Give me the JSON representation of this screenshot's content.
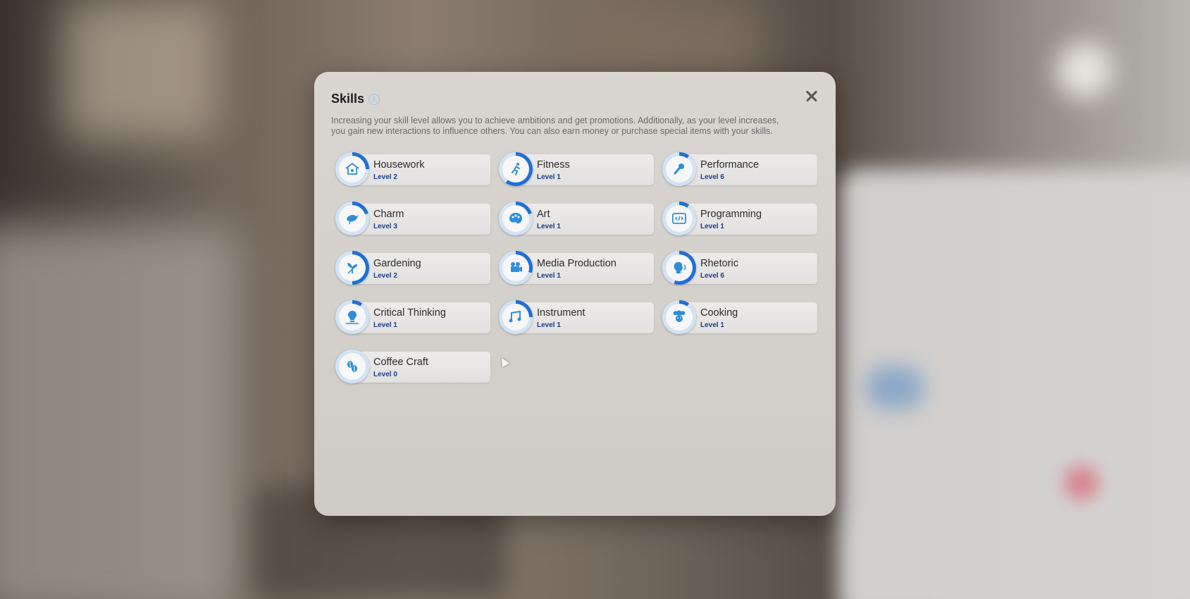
{
  "dialog": {
    "title": "Skills",
    "info_icon": "info-icon",
    "close_icon": "close-icon",
    "description_line1": "Increasing your skill level allows you to achieve ambitions and get promotions. Additionally, as your level increases,",
    "description_line2": "you gain new interactions to influence others. You can also earn money or purchase special items with your skills."
  },
  "colors": {
    "accent": "#1f6fd6",
    "accent_light": "#9ec2ea",
    "level_text": "#1b3f86",
    "icon": "#2f8ed8"
  },
  "skills": [
    {
      "name": "Housework",
      "level": "Level 2",
      "progress": 0.25,
      "icon": "house-icon"
    },
    {
      "name": "Fitness",
      "level": "Level 1",
      "progress": 0.6,
      "icon": "runner-icon"
    },
    {
      "name": "Performance",
      "level": "Level 6",
      "progress": 0.1,
      "icon": "microphone-icon"
    },
    {
      "name": "Charm",
      "level": "Level 3",
      "progress": 0.2,
      "icon": "bird-icon"
    },
    {
      "name": "Art",
      "level": "Level 1",
      "progress": 0.2,
      "icon": "palette-icon"
    },
    {
      "name": "Programming",
      "level": "Level 1",
      "progress": 0.1,
      "icon": "code-icon"
    },
    {
      "name": "Gardening",
      "level": "Level 2",
      "progress": 0.5,
      "icon": "sprout-icon"
    },
    {
      "name": "Media Production",
      "level": "Level 1",
      "progress": 0.3,
      "icon": "camera-icon"
    },
    {
      "name": "Rhetoric",
      "level": "Level 6",
      "progress": 0.55,
      "icon": "speaking-head-icon"
    },
    {
      "name": "Critical Thinking",
      "level": "Level 1",
      "progress": 0.1,
      "icon": "lightbulb-icon"
    },
    {
      "name": "Instrument",
      "level": "Level 1",
      "progress": 0.25,
      "icon": "music-notes-icon"
    },
    {
      "name": "Cooking",
      "level": "Level 1",
      "progress": 0.1,
      "icon": "chef-icon"
    },
    {
      "name": "Coffee Craft",
      "level": "Level 0",
      "progress": 0.0,
      "icon": "coffee-beans-icon"
    }
  ]
}
